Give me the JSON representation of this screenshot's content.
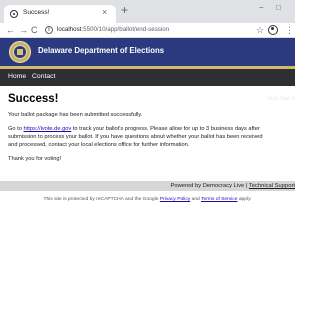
{
  "browser": {
    "tab_title": "Success!",
    "tab_close": "×",
    "new_tab": "+",
    "win_min": "−",
    "win_max": "□",
    "url_host": "localhost",
    "url_rest": ":5500/10/app/ballot/end-session",
    "nav_back": "←",
    "nav_forward": "→",
    "nav_reload": "C",
    "info": "i",
    "star": "☆",
    "menu": "⋮"
  },
  "header": {
    "site_title": "Delaware Department of Elections",
    "font_size_label": "Font Size: A",
    "nav": [
      "Home",
      "Contact"
    ]
  },
  "main": {
    "title": "Success!",
    "para1": "Your ballot package has been submitted successfully.",
    "para2_before_link": "Go to ",
    "para2_link": "https://ivote.de.gov",
    "para2_line1_after_link": " to track your ballot's progress. Please allow for up to 3 business days after",
    "para2_line2": "submission to process your ballot.  If you have questions about whether your ballot has been received",
    "para2_line3": "and processed, contact your local elections office for further information.",
    "para3": "Thank you for voting!"
  },
  "footer": {
    "powered_text": "Powered by Democracy Live | ",
    "technical_support": "Technical Support",
    "recaptcha_before": "This site is protected by reCAPTCHA and the Google ",
    "privacy_policy": "Privacy Policy",
    "recaptcha_and": " and ",
    "terms_of_service": "Terms of Service",
    "recaptcha_after": " apply."
  }
}
